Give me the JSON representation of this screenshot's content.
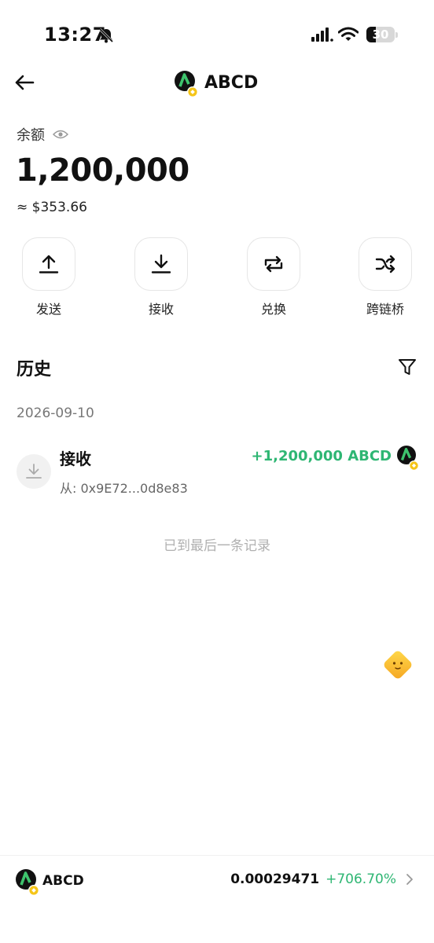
{
  "status_bar": {
    "time": "13:27",
    "battery": "30"
  },
  "header": {
    "title": "ABCD"
  },
  "balance": {
    "label": "余额",
    "amount": "1,200,000",
    "usd": "≈ $353.66"
  },
  "actions": [
    {
      "label": "发送",
      "icon": "upload-icon"
    },
    {
      "label": "接收",
      "icon": "download-icon"
    },
    {
      "label": "兑换",
      "icon": "swap-icon"
    },
    {
      "label": "跨链桥",
      "icon": "shuffle-icon"
    }
  ],
  "history": {
    "title": "历史",
    "date": "2026-09-10",
    "transactions": [
      {
        "type": "接收",
        "from": "从: 0x9E72...0d8e83",
        "amount": "+1,200,000 ABCD"
      }
    ],
    "end_label": "已到最后一条记录"
  },
  "footer": {
    "token": "ABCD",
    "price": "0.00029471",
    "change": "+706.70%"
  },
  "colors": {
    "positive": "#2eb673",
    "logo_bg": "#111111",
    "logo_mark": "#3ec46d",
    "badge": "#f5c518"
  }
}
